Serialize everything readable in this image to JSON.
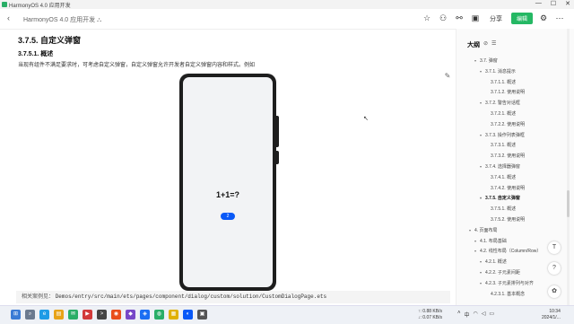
{
  "window": {
    "app_title": "HarmonyOS 4.0 应用开发",
    "controls": [
      "—",
      "☐",
      "✕"
    ]
  },
  "doc": {
    "title": "HarmonyOS 4.0 应用开发 ⛬",
    "share_label": "分享",
    "publish_label": "编辑"
  },
  "content": {
    "heading": "3.7.5. 自定义弹窗",
    "subheading": "3.7.5.1. 概述",
    "paragraph": "当现有组件不满足要求时，可考虑自定义弹窗，自定义弹窗允许开发者自定义弹窗内容和样式。例如",
    "phone": {
      "equation": "1+1=?",
      "button_label": "2"
    },
    "code": {
      "label": "相关案例见：",
      "path": "Demos/entry/src/main/ets/pages/component/dialog/custom/solution/CustomDialogPage.ets"
    }
  },
  "outline": {
    "title": "大纲",
    "items": [
      {
        "label": "3.7. 弹窗",
        "active": false
      },
      {
        "label": "3.7.1. 消息提示",
        "active": false
      },
      {
        "label": "3.7.1.1. 概述",
        "active": false
      },
      {
        "label": "3.7.1.2. 使用说明",
        "active": false
      },
      {
        "label": "3.7.2. 警告对话框",
        "active": false
      },
      {
        "label": "3.7.2.1. 概述",
        "active": false
      },
      {
        "label": "3.7.2.2. 使用说明",
        "active": false
      },
      {
        "label": "3.7.3. 操作列表弹框",
        "active": false
      },
      {
        "label": "3.7.3.1. 概述",
        "active": false
      },
      {
        "label": "3.7.3.2. 使用说明",
        "active": false
      },
      {
        "label": "3.7.4. 选择器弹窗",
        "active": false
      },
      {
        "label": "3.7.4.1. 概述",
        "active": false
      },
      {
        "label": "3.7.4.2. 使用说明",
        "active": false
      },
      {
        "label": "3.7.5. 自定义弹窗",
        "active": true
      },
      {
        "label": "3.7.5.1. 概述",
        "active": false
      },
      {
        "label": "3.7.5.2. 使用说明",
        "active": false
      },
      {
        "label": "4. 页面布局",
        "active": false
      },
      {
        "label": "4.1. 布局基础",
        "active": false
      },
      {
        "label": "4.2. 线性布局（Column/Row）",
        "active": false
      },
      {
        "label": "4.2.1. 概述",
        "active": false
      },
      {
        "label": "4.2.2. 子元素间距",
        "active": false
      },
      {
        "label": "4.2.3. 子元素排列与对齐",
        "active": false
      },
      {
        "label": "4.2.3.1. 基本概念",
        "active": false
      }
    ]
  },
  "system": {
    "upload_speed": "↑: 0.88 KB/s",
    "download_speed": "↓: 0.07 KB/s",
    "ime": "中",
    "time": "10:34",
    "date": "2024/1/..."
  },
  "colors": {
    "accent": "#25b864",
    "dialog_button": "#0a59f7"
  }
}
